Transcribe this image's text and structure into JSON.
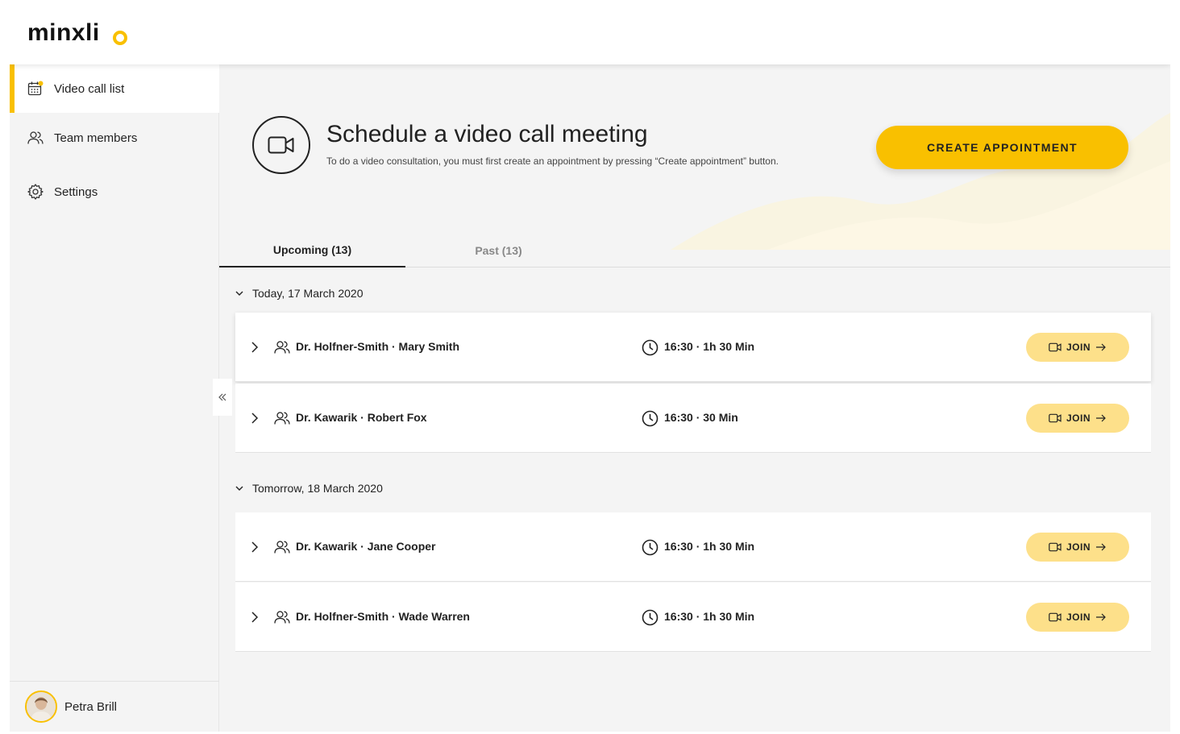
{
  "app": {
    "logo": "minxli"
  },
  "sidebar": {
    "items": [
      {
        "label": "Video call list",
        "icon": "calendar-icon",
        "active": true
      },
      {
        "label": "Team members",
        "icon": "people-icon",
        "active": false
      },
      {
        "label": "Settings",
        "icon": "gear-icon",
        "active": false
      }
    ],
    "user": {
      "name": "Petra Brill"
    }
  },
  "hero": {
    "title": "Schedule a video call meeting",
    "subtitle": "To do a video consultation, you must first create an appointment by pressing “Create appointment” button.",
    "create_label": "CREATE APPOINTMENT"
  },
  "tabs": [
    {
      "label": "Upcoming (13)",
      "active": true
    },
    {
      "label": "Past (13)",
      "active": false
    }
  ],
  "groups": [
    {
      "header": "Today, 17 March 2020",
      "rows": [
        {
          "names": "Dr. Holfner-Smith · Mary Smith",
          "time": "16:30 · 1h 30 Min",
          "join": "JOIN"
        },
        {
          "names": "Dr. Kawarik  · Robert Fox",
          "time": "16:30 · 30 Min",
          "join": "JOIN"
        }
      ]
    },
    {
      "header": "Tomorrow, 18 March 2020",
      "rows": [
        {
          "names": "Dr. Kawarik · Jane Cooper",
          "time": "16:30 · 1h 30 Min",
          "join": "JOIN"
        },
        {
          "names": "Dr. Holfner-Smith · Wade Warren",
          "time": "16:30 · 1h 30 Min",
          "join": "JOIN"
        }
      ]
    }
  ],
  "colors": {
    "accent": "#f9c000",
    "join_bg": "#fde08a",
    "background": "#f4f4f4"
  }
}
